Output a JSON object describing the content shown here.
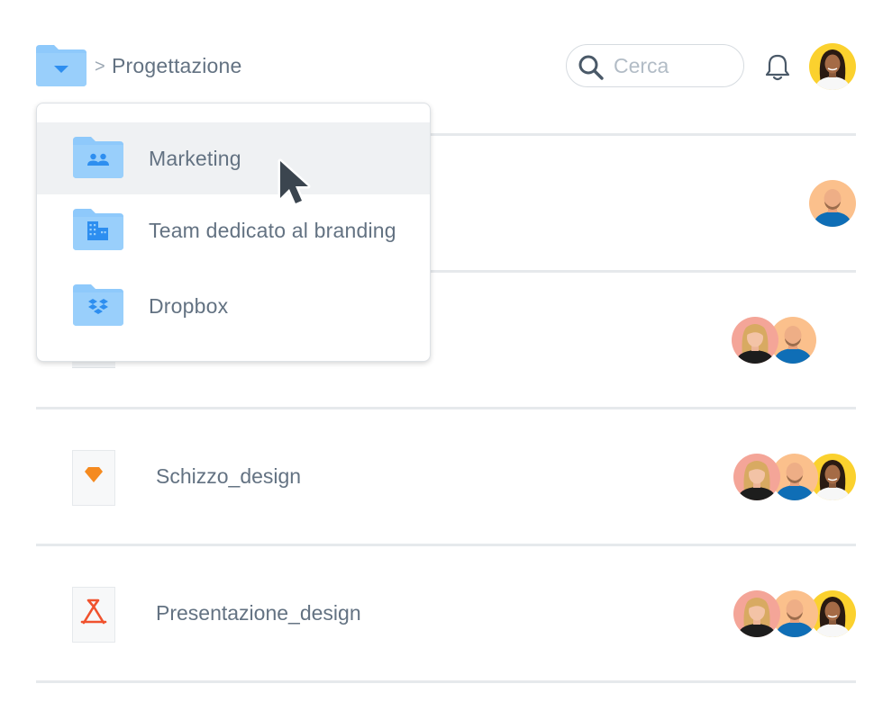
{
  "breadcrumb": {
    "separator": ">",
    "current": "Progettazione"
  },
  "search": {
    "placeholder": "Cerca",
    "value": ""
  },
  "dropdown": {
    "items": [
      {
        "label": "Marketing",
        "icon": "shared-team-folder-icon"
      },
      {
        "label": "Team dedicato al branding",
        "icon": "company-folder-icon"
      },
      {
        "label": "Dropbox",
        "icon": "dropbox-folder-icon"
      }
    ],
    "hovered_item": "Marketing"
  },
  "files": [
    {
      "name": "",
      "icon": "file-icon",
      "collaborators": [
        "avatar-man"
      ]
    },
    {
      "name": "",
      "icon": "file-icon",
      "collaborators": [
        "avatar-woman-blonde",
        "avatar-man"
      ]
    },
    {
      "name": "Schizzo_design",
      "icon": "sketch-file-icon",
      "collaborators": [
        "avatar-woman-blonde",
        "avatar-man",
        "avatar-woman-dark"
      ]
    },
    {
      "name": "Presentazione_design",
      "icon": "pdf-file-icon",
      "collaborators": [
        "avatar-woman-blonde",
        "avatar-man",
        "avatar-woman-dark"
      ]
    }
  ],
  "colors": {
    "folder": "#8ec9fb",
    "folder_glyph": "#2d8ef0",
    "text": "#637282",
    "divider": "#e6e9ec",
    "sketch": "#f58a1f",
    "pdf": "#f0522e",
    "avatar_peach": "#fbc08c",
    "avatar_pink": "#f4a598",
    "avatar_yellow": "#fbd12e"
  }
}
